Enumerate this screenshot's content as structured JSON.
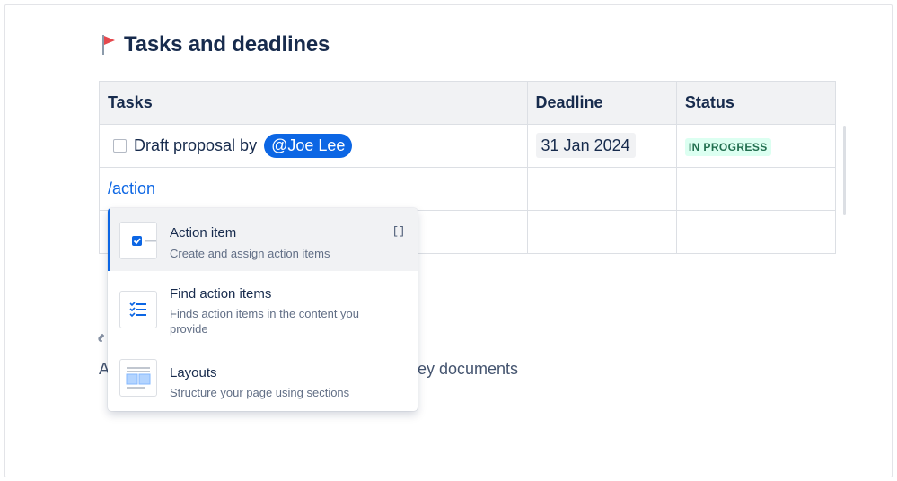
{
  "section": {
    "title": "Tasks and deadlines",
    "flag_color": "#e5484d"
  },
  "table": {
    "headers": [
      "Tasks",
      "Deadline",
      "Status"
    ],
    "row1": {
      "task_text": "Draft proposal by",
      "mention": "@Joe Lee",
      "deadline": "31 Jan 2024",
      "status": "IN PROGRESS"
    },
    "row2": {
      "input_text": "/action"
    }
  },
  "background": {
    "text_left": "A",
    "text_right": "ey documents"
  },
  "menu": {
    "items": [
      {
        "title": "Action item",
        "description": "Create and assign action items",
        "shortcut": "[]"
      },
      {
        "title": "Find action items",
        "description": "Finds action items in the content you provide"
      },
      {
        "title": "Layouts",
        "description": "Structure your page using sections"
      }
    ]
  },
  "colors": {
    "accent": "#0c66e4",
    "status_bg": "#dcfff1",
    "status_text": "#216e4e"
  }
}
